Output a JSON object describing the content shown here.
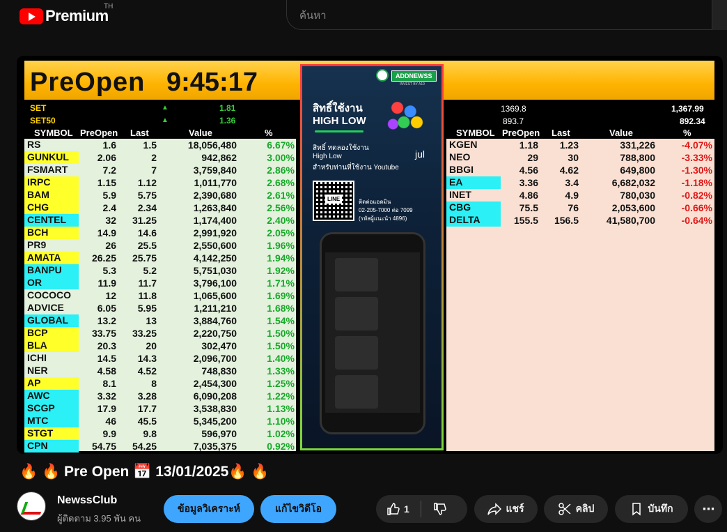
{
  "header": {
    "brand": "Premium",
    "country": "TH",
    "search_placeholder": "ค้นหา"
  },
  "video": {
    "banner": {
      "title": "PreOpen",
      "time": "9:45:17"
    },
    "indices": [
      {
        "name": "SET",
        "change": "1.81",
        "prev": "1369.8",
        "last": "1,367.99"
      },
      {
        "name": "SET50",
        "change": "1.36",
        "prev": "893.7",
        "last": "892.34"
      }
    ],
    "columns": [
      "SYMBOL",
      "PreOpen",
      "Last",
      "Value",
      "%"
    ],
    "left_table": [
      {
        "symbol": "RS",
        "preopen": "1.6",
        "last": "1.5",
        "value": "18,056,480",
        "pct": "6.67%",
        "hl": ""
      },
      {
        "symbol": "GUNKUL",
        "preopen": "2.06",
        "last": "2",
        "value": "942,862",
        "pct": "3.00%",
        "hl": "y"
      },
      {
        "symbol": "FSMART",
        "preopen": "7.2",
        "last": "7",
        "value": "3,759,840",
        "pct": "2.86%",
        "hl": ""
      },
      {
        "symbol": "IRPC",
        "preopen": "1.15",
        "last": "1.12",
        "value": "1,011,770",
        "pct": "2.68%",
        "hl": "y"
      },
      {
        "symbol": "BAM",
        "preopen": "5.9",
        "last": "5.75",
        "value": "2,390,680",
        "pct": "2.61%",
        "hl": "y"
      },
      {
        "symbol": "CHG",
        "preopen": "2.4",
        "last": "2.34",
        "value": "1,263,840",
        "pct": "2.56%",
        "hl": "y"
      },
      {
        "symbol": "CENTEL",
        "preopen": "32",
        "last": "31.25",
        "value": "1,174,400",
        "pct": "2.40%",
        "hl": "c"
      },
      {
        "symbol": "BCH",
        "preopen": "14.9",
        "last": "14.6",
        "value": "2,991,920",
        "pct": "2.05%",
        "hl": "y"
      },
      {
        "symbol": "PR9",
        "preopen": "26",
        "last": "25.5",
        "value": "2,550,600",
        "pct": "1.96%",
        "hl": ""
      },
      {
        "symbol": "AMATA",
        "preopen": "26.25",
        "last": "25.75",
        "value": "4,142,250",
        "pct": "1.94%",
        "hl": "y"
      },
      {
        "symbol": "BANPU",
        "preopen": "5.3",
        "last": "5.2",
        "value": "5,751,030",
        "pct": "1.92%",
        "hl": "c"
      },
      {
        "symbol": "OR",
        "preopen": "11.9",
        "last": "11.7",
        "value": "3,796,100",
        "pct": "1.71%",
        "hl": "c"
      },
      {
        "symbol": "COCOCO",
        "preopen": "12",
        "last": "11.8",
        "value": "1,065,600",
        "pct": "1.69%",
        "hl": ""
      },
      {
        "symbol": "ADVICE",
        "preopen": "6.05",
        "last": "5.95",
        "value": "1,211,210",
        "pct": "1.68%",
        "hl": ""
      },
      {
        "symbol": "GLOBAL",
        "preopen": "13.2",
        "last": "13",
        "value": "3,884,760",
        "pct": "1.54%",
        "hl": "c"
      },
      {
        "symbol": "BCP",
        "preopen": "33.75",
        "last": "33.25",
        "value": "2,220,750",
        "pct": "1.50%",
        "hl": "y"
      },
      {
        "symbol": "BLA",
        "preopen": "20.3",
        "last": "20",
        "value": "302,470",
        "pct": "1.50%",
        "hl": "y"
      },
      {
        "symbol": "ICHI",
        "preopen": "14.5",
        "last": "14.3",
        "value": "2,096,700",
        "pct": "1.40%",
        "hl": ""
      },
      {
        "symbol": "NER",
        "preopen": "4.58",
        "last": "4.52",
        "value": "748,830",
        "pct": "1.33%",
        "hl": ""
      },
      {
        "symbol": "AP",
        "preopen": "8.1",
        "last": "8",
        "value": "2,454,300",
        "pct": "1.25%",
        "hl": "y"
      },
      {
        "symbol": "AWC",
        "preopen": "3.32",
        "last": "3.28",
        "value": "6,090,208",
        "pct": "1.22%",
        "hl": "c"
      },
      {
        "symbol": "SCGP",
        "preopen": "17.9",
        "last": "17.7",
        "value": "3,538,830",
        "pct": "1.13%",
        "hl": "c"
      },
      {
        "symbol": "MTC",
        "preopen": "46",
        "last": "45.5",
        "value": "5,345,200",
        "pct": "1.10%",
        "hl": "c"
      },
      {
        "symbol": "STGT",
        "preopen": "9.9",
        "last": "9.8",
        "value": "596,970",
        "pct": "1.02%",
        "hl": "y"
      },
      {
        "symbol": "CPN",
        "preopen": "54.75",
        "last": "54.25",
        "value": "7,035,375",
        "pct": "0.92%",
        "hl": "c"
      }
    ],
    "right_table": [
      {
        "symbol": "KGEN",
        "preopen": "1.18",
        "last": "1.23",
        "value": "331,226",
        "pct": "-4.07%",
        "hl": ""
      },
      {
        "symbol": "NEO",
        "preopen": "29",
        "last": "30",
        "value": "788,800",
        "pct": "-3.33%",
        "hl": ""
      },
      {
        "symbol": "BBGI",
        "preopen": "4.56",
        "last": "4.62",
        "value": "649,800",
        "pct": "-1.30%",
        "hl": ""
      },
      {
        "symbol": "EA",
        "preopen": "3.36",
        "last": "3.4",
        "value": "6,682,032",
        "pct": "-1.18%",
        "hl": "c"
      },
      {
        "symbol": "INET",
        "preopen": "4.86",
        "last": "4.9",
        "value": "780,030",
        "pct": "-0.82%",
        "hl": ""
      },
      {
        "symbol": "CBG",
        "preopen": "75.5",
        "last": "76",
        "value": "2,053,600",
        "pct": "-0.66%",
        "hl": "c"
      },
      {
        "symbol": "DELTA",
        "preopen": "155.5",
        "last": "156.5",
        "value": "41,580,700",
        "pct": "-0.64%",
        "hl": "c"
      }
    ],
    "ad": {
      "tag": "ADDNEWSS",
      "sub": "INVEST BY A19",
      "h1": "สิทธิ์ใช้งาน",
      "h2": "HIGH LOW",
      "l1": "สิทธิ์ ทดลองใช้งาน",
      "l2": "High Low",
      "l3": "สำหรับท่านที่ใช้งาน Youtube",
      "line": "LINE",
      "c1": "ติดต่อแอดมิน",
      "c2": "02-205-7000 ต่อ 7099",
      "c3": "(รหัสผู้แนะนำ 4896)",
      "month": "jul"
    }
  },
  "title": "Pre Open",
  "date": "13/01/2025",
  "channel": {
    "name": "NewssClub",
    "subscribers": "ผู้ติดตาม 3.95 พัน คน"
  },
  "actions": {
    "analysis": "ข้อมูลวิเคราะห์",
    "edit": "แก้ไขวิดีโอ",
    "likes": "1",
    "share": "แชร์",
    "clip": "คลิป",
    "save": "บันทึก"
  }
}
